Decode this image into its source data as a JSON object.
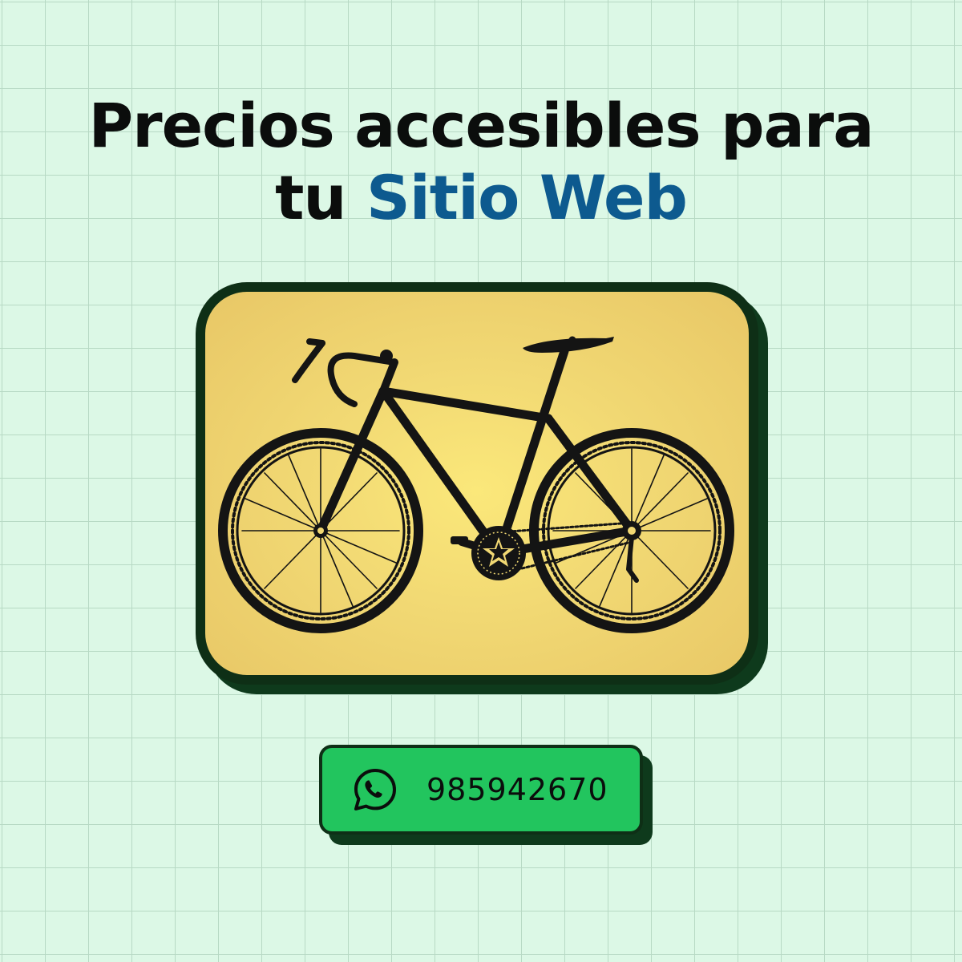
{
  "headline": {
    "line1": "Precios accesibles para",
    "line2_prefix": "tu",
    "line2_accent": "Sitio Web"
  },
  "illustration": {
    "subject": "bicycle",
    "card_color": "#f1d873",
    "frame_color": "#0e2f16"
  },
  "contact": {
    "icon": "whatsapp-icon",
    "phone": "985942670",
    "button_color": "#22c55e"
  },
  "colors": {
    "background": "#dcf8e6",
    "text": "#0b0d0c",
    "accent": "#0d5a8f"
  }
}
